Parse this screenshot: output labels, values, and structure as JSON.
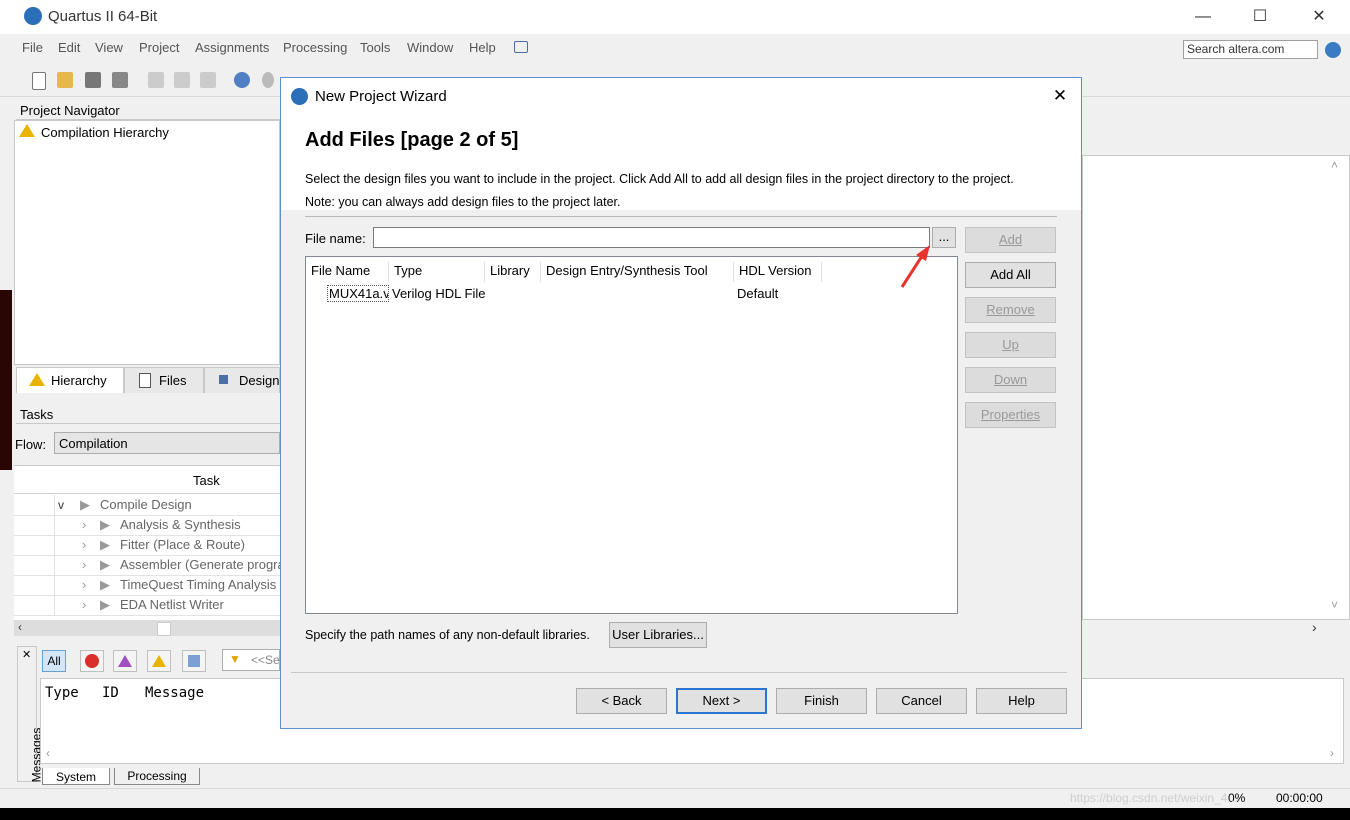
{
  "app": {
    "title": "Quartus II 64-Bit"
  },
  "window_controls": {
    "minimize": "—",
    "maximize": "☐",
    "close": "✕"
  },
  "menu": [
    "File",
    "Edit",
    "View",
    "Project",
    "Assignments",
    "Processing",
    "Tools",
    "Window",
    "Help"
  ],
  "search": {
    "placeholder": "Search altera.com"
  },
  "project_navigator": {
    "title": "Project Navigator",
    "item": "Compilation Hierarchy",
    "tabs": [
      "Hierarchy",
      "Files",
      "Design"
    ]
  },
  "tasks": {
    "title": "Tasks",
    "flow_label": "Flow:",
    "flow_value": "Compilation",
    "column": "Task",
    "rows": [
      "Compile Design",
      "Analysis & Synthesis",
      "Fitter (Place & Route)",
      "Assembler (Generate progra",
      "TimeQuest Timing Analysis",
      "EDA Netlist Writer"
    ]
  },
  "messages": {
    "filter_all": "All",
    "search_placeholder": "<<Se",
    "columns": {
      "type": "Type",
      "id": "ID",
      "message": "Message"
    },
    "side_label": "Messages",
    "tabs": [
      "System",
      "Processing"
    ]
  },
  "status": {
    "progress": "0%",
    "time": "00:00:00",
    "watermark": "https://blog.csdn.net/weixin_4..."
  },
  "dialog": {
    "title": "New Project Wizard",
    "heading": "Add Files [page 2 of 5]",
    "desc1": "Select the design files you want to include in the project. Click Add All to add all design files in the project directory to the project.",
    "desc2": "Note: you can always add design files to the project later.",
    "file_name_label": "File name:",
    "file_name_value": "",
    "browse_label": "...",
    "table": {
      "headers": [
        "File Name",
        "Type",
        "Library",
        "Design Entry/Synthesis Tool",
        "HDL Version"
      ],
      "rows": [
        {
          "file": "MUX41a.v",
          "type": "Verilog HDL File",
          "library": "",
          "tool": "",
          "hdl": "Default"
        }
      ]
    },
    "side_buttons": {
      "add": "Add",
      "add_all": "Add All",
      "remove": "Remove",
      "up": "Up",
      "down": "Down",
      "properties": "Properties"
    },
    "libraries_text": "Specify the path names of any non-default libraries.",
    "user_libraries": "User Libraries...",
    "footer": {
      "back": "< Back",
      "next": "Next >",
      "finish": "Finish",
      "cancel": "Cancel",
      "help": "Help"
    }
  },
  "colors": {
    "accent": "#2b74d0",
    "arrow": "#e8322b"
  }
}
